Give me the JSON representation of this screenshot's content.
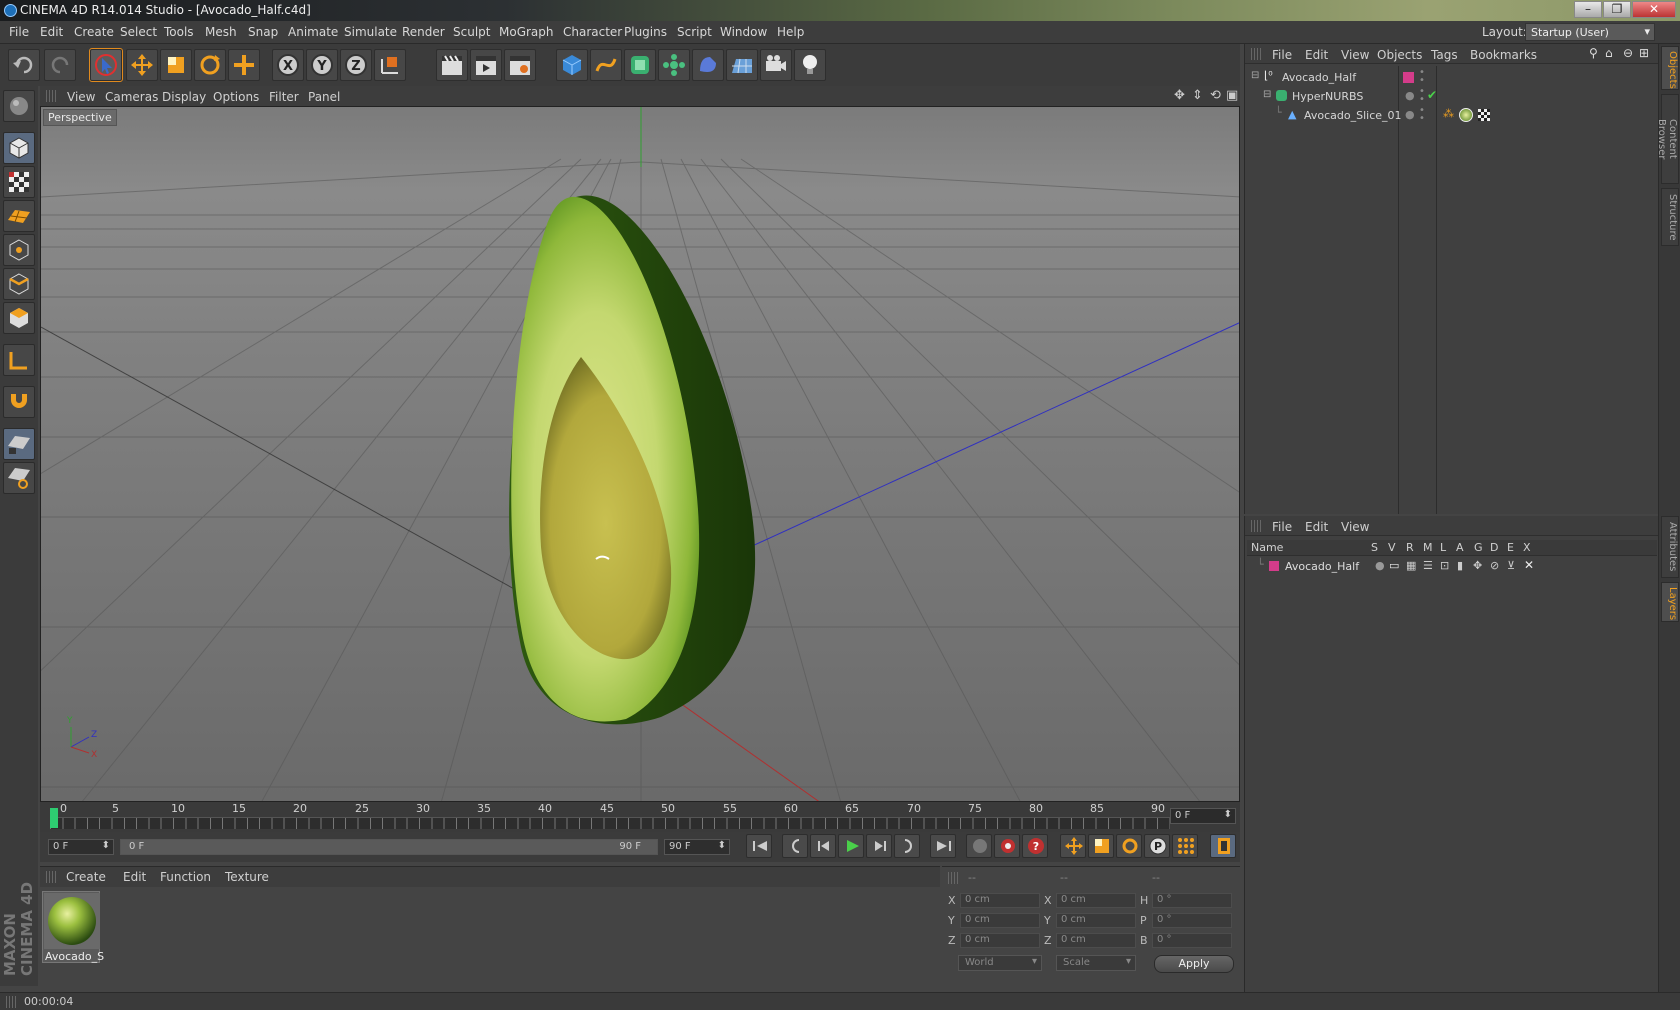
{
  "window": {
    "title": "CINEMA 4D R14.014 Studio - [Avocado_Half.c4d]"
  },
  "menu": [
    "File",
    "Edit",
    "Create",
    "Select",
    "Tools",
    "Mesh",
    "Snap",
    "Animate",
    "Simulate",
    "Render",
    "Sculpt",
    "MoGraph",
    "Character",
    "Plugins",
    "Script",
    "Window",
    "Help"
  ],
  "layout": {
    "label": "Layout:",
    "value": "Startup (User)"
  },
  "viewport": {
    "menu": [
      "View",
      "Cameras",
      "Display",
      "Options",
      "Filter",
      "Panel"
    ],
    "label": "Perspective"
  },
  "timeline": {
    "ticks": [
      "0",
      "5",
      "10",
      "15",
      "20",
      "25",
      "30",
      "35",
      "40",
      "45",
      "50",
      "55",
      "60",
      "65",
      "70",
      "75",
      "80",
      "85",
      "90"
    ],
    "current_frame": "0 F",
    "start_frame": "0 F",
    "range_start": "0 F",
    "range_end": "90 F",
    "end_frame": "90 F"
  },
  "materials": {
    "menu": [
      "Create",
      "Edit",
      "Function",
      "Texture"
    ],
    "items": [
      {
        "name": "Avocado_S"
      }
    ]
  },
  "coordinates": {
    "headers": [
      "--",
      "--",
      "--"
    ],
    "rows": [
      {
        "a": "X",
        "av": "0 cm",
        "b": "X",
        "bv": "0 cm",
        "c": "H",
        "cv": "0 °"
      },
      {
        "a": "Y",
        "av": "0 cm",
        "b": "Y",
        "bv": "0 cm",
        "c": "P",
        "cv": "0 °"
      },
      {
        "a": "Z",
        "av": "0 cm",
        "b": "Z",
        "bv": "0 cm",
        "c": "B",
        "cv": "0 °"
      }
    ],
    "space": "World",
    "mode": "Scale",
    "apply": "Apply"
  },
  "objects": {
    "menu": [
      "File",
      "Edit",
      "View",
      "Objects",
      "Tags",
      "Bookmarks"
    ],
    "tree": [
      {
        "name": "Avocado_Half",
        "depth": 0
      },
      {
        "name": "HyperNURBS",
        "depth": 1
      },
      {
        "name": "Avocado_Slice_01",
        "depth": 2
      }
    ]
  },
  "layers": {
    "menu": [
      "File",
      "Edit",
      "View"
    ],
    "columns": [
      "Name",
      "S",
      "V",
      "R",
      "M",
      "L",
      "A",
      "G",
      "D",
      "E",
      "X"
    ],
    "rows": [
      {
        "name": "Avocado_Half",
        "color": "#d43c8a"
      }
    ]
  },
  "side_tabs": [
    "Objects",
    "Content Browser",
    "Structure",
    "Attributes",
    "Layers"
  ],
  "branding": "MAXON CINEMA 4D",
  "status": {
    "text": "00:00:04"
  },
  "colors": {
    "accent": "#e08a1e",
    "layer": "#d43c8a",
    "axis_x": "#b03030",
    "axis_z": "#3030c0",
    "axis_y": "#30a030"
  }
}
